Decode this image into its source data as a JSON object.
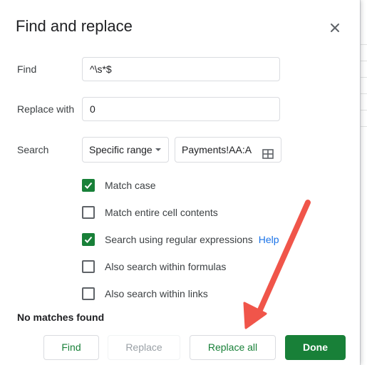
{
  "dialog": {
    "title": "Find and replace",
    "close_icon": "close-icon"
  },
  "fields": {
    "find_label": "Find",
    "find_value": "^\\s*$",
    "replace_label": "Replace with",
    "replace_value": "0",
    "search_label": "Search",
    "search_scope": "Specific range",
    "range_value": "Payments!AA:A",
    "range_icon": "grid-select-icon"
  },
  "options": [
    {
      "label": "Match case",
      "checked": true
    },
    {
      "label": "Match entire cell contents",
      "checked": false
    },
    {
      "label": "Search using regular expressions",
      "checked": true,
      "help": "Help"
    },
    {
      "label": "Also search within formulas",
      "checked": false
    },
    {
      "label": "Also search within links",
      "checked": false
    }
  ],
  "status": "No matches found",
  "buttons": {
    "find": "Find",
    "replace": "Replace",
    "replace_all": "Replace all",
    "done": "Done"
  },
  "colors": {
    "accent_green": "#188038",
    "link_blue": "#1a73e8",
    "annotation_arrow": "#f0554a"
  }
}
